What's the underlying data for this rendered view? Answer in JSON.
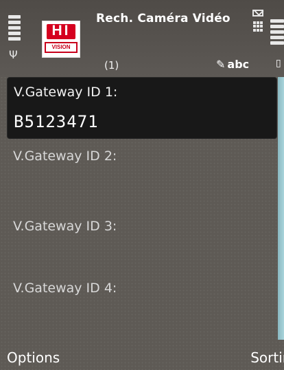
{
  "status": {
    "app_title": "Rech. Caméra Vidéo",
    "page_counter": "(1)",
    "input_mode": "abc",
    "logo_text_top": "HI",
    "logo_text_bottom": "VISION"
  },
  "fields": [
    {
      "label": "V.Gateway ID 1:",
      "value": "B5123471",
      "focused": true
    },
    {
      "label": "V.Gateway ID 2:",
      "value": ""
    },
    {
      "label": "V.Gateway ID 3:",
      "value": ""
    },
    {
      "label": "V.Gateway ID 4:",
      "value": ""
    }
  ],
  "softkeys": {
    "left": "Options",
    "right": "Sortir"
  },
  "colors": {
    "background": "#5e5a55",
    "focused_field": "#181818",
    "scrollbar": "#a9d4db",
    "logo_red": "#d5001f"
  }
}
